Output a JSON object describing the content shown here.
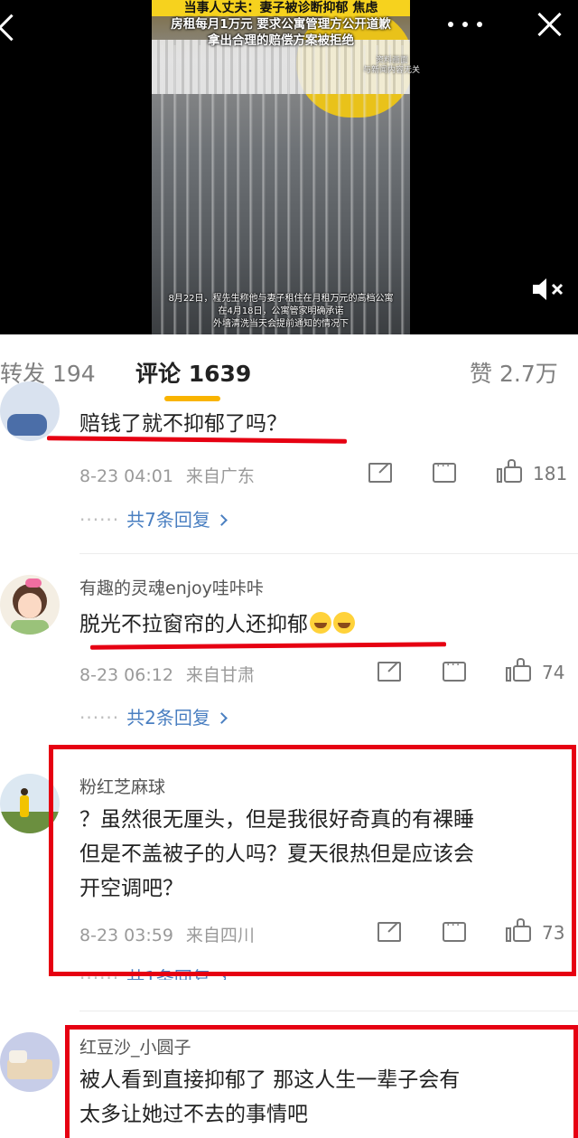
{
  "video": {
    "headline_top": "当事人丈夫：妻子被诊断抑郁 焦虑",
    "headline_line2": "房租每月1万元 要求公寓管理方公开道歉",
    "headline_line3": "拿出合理的赔偿方案被拒绝",
    "source_note_1": "资料画面",
    "source_note_2": "与新闻内容无关",
    "caption_1": "8月22日，程先生称他与妻子租住在月租万元的高档公寓",
    "caption_2": "在4月18日，公寓管家明确承诺",
    "caption_3": "外墙清洗当天会提前通知的情况下"
  },
  "tabs": {
    "repost": {
      "label": "转发",
      "count": "194"
    },
    "comment": {
      "label": "评论",
      "count": "1639"
    },
    "like": {
      "label": "赞",
      "count": "2.7万"
    }
  },
  "comments": [
    {
      "username": "",
      "text": "赔钱了就不抑郁了吗？",
      "date": "8-23 04:01",
      "location": "来自广东",
      "likes": "181",
      "replies": "共7条回复"
    },
    {
      "username": "有趣的灵魂enjoy哇咔咔",
      "text": "脱光不拉窗帘的人还抑郁",
      "date": "8-23 06:12",
      "location": "来自甘肃",
      "likes": "74",
      "replies": "共2条回复"
    },
    {
      "username": "粉红芝麻球",
      "text_line1": "？虽然很无厘头，但是我很好奇真的有裸睡",
      "text_line2": "但是不盖被子的人吗？夏天很热但是应该会",
      "text_line3": "开空调吧？",
      "date": "8-23 03:59",
      "location": "来自四川",
      "likes": "73",
      "replies": "共1条回复"
    },
    {
      "username": "红豆沙_小圆子",
      "text_line1": "被人看到直接抑郁了 那这人生一辈子会有",
      "text_line2": "太多让她过不去的事情吧"
    }
  ],
  "colors": {
    "highlight": "#e60012",
    "accent": "#f9b400",
    "link": "#4a7fc1"
  }
}
